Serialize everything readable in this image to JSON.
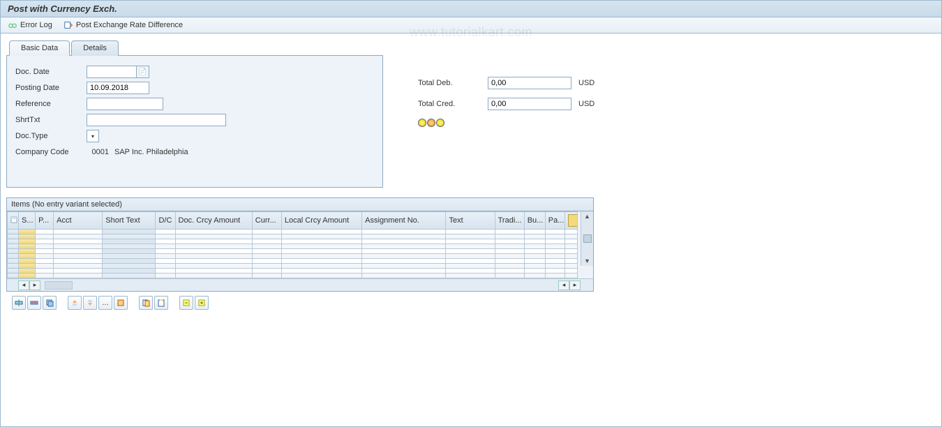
{
  "title": "Post with Currency Exch.",
  "toolbar": {
    "error_log": "Error Log",
    "post_diff": "Post Exchange Rate Difference"
  },
  "watermark": "www.tutorialkart.com",
  "tabs": {
    "basic": "Basic Data",
    "details": "Details",
    "active": "basic"
  },
  "form": {
    "doc_date_label": "Doc. Date",
    "doc_date": "",
    "posting_date_label": "Posting Date",
    "posting_date": "10.09.2018",
    "reference_label": "Reference",
    "reference": "",
    "shrt_txt_label": "ShrtTxt",
    "shrt_txt": "",
    "doc_type_label": "Doc.Type",
    "company_code_label": "Company Code",
    "company_code": "0001",
    "company_name": "SAP Inc. Philadelphia"
  },
  "totals": {
    "deb_label": "Total Deb.",
    "deb_value": "0,00",
    "cred_label": "Total Cred.",
    "cred_value": "0,00",
    "currency": "USD"
  },
  "items": {
    "section_title": "Items (No entry variant selected)",
    "columns": [
      "S...",
      "P...",
      "Acct",
      "Short Text",
      "D/C",
      "Doc. Crcy Amount",
      "Curr...",
      "Local Crcy Amount",
      "Assignment No.",
      "Text",
      "Tradi...",
      "Bu...",
      "Pa..."
    ],
    "rows": 10
  }
}
